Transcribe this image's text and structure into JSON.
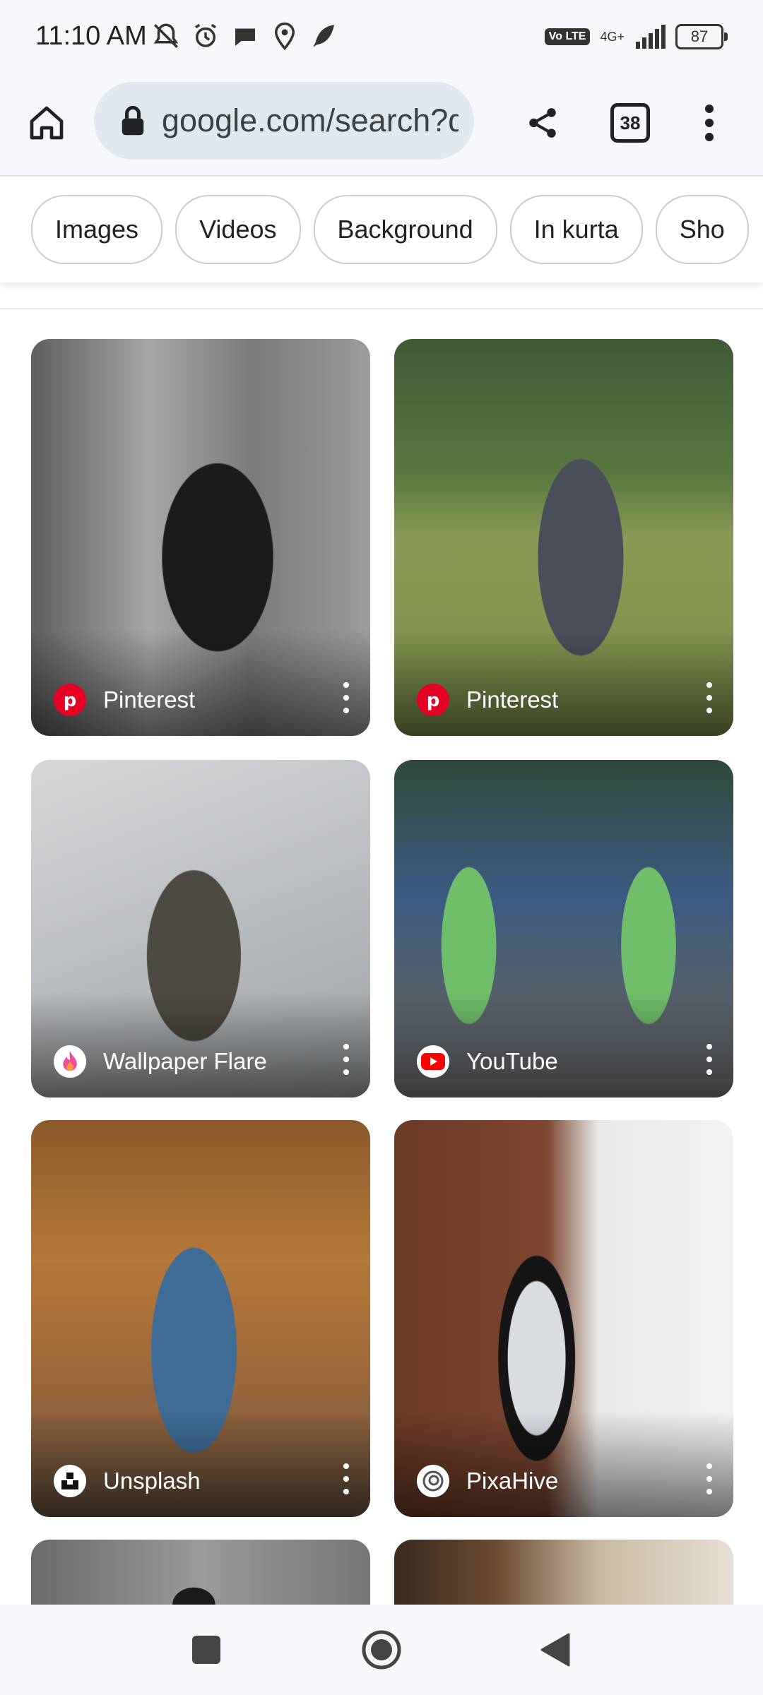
{
  "status_bar": {
    "time": "11:10 AM",
    "volte": "Vo LTE",
    "network": "4G+",
    "battery": "87",
    "icons": [
      "mute-icon",
      "alarm-icon",
      "chat-icon",
      "location-icon",
      "feather-icon"
    ]
  },
  "toolbar": {
    "url": "google.com/search?q",
    "tab_count": "38"
  },
  "chips": [
    {
      "label": "Images"
    },
    {
      "label": "Videos"
    },
    {
      "label": "Background"
    },
    {
      "label": "In kurta"
    },
    {
      "label": "Sho"
    }
  ],
  "results": [
    {
      "source": "Pinterest",
      "icon": "pinterest-icon"
    },
    {
      "source": "Pinterest",
      "icon": "pinterest-icon"
    },
    {
      "source": "Wallpaper Flare",
      "icon": "wallpaper-flare-icon"
    },
    {
      "source": "YouTube",
      "icon": "youtube-icon"
    },
    {
      "source": "Unsplash",
      "icon": "unsplash-icon"
    },
    {
      "source": "PixaHive",
      "icon": "pixahive-icon"
    }
  ],
  "colors": {
    "chrome_bg": "#f6f7fb",
    "url_bar_bg": "#e1e9ee",
    "pinterest": "#e60023",
    "youtube": "#ff0000"
  }
}
